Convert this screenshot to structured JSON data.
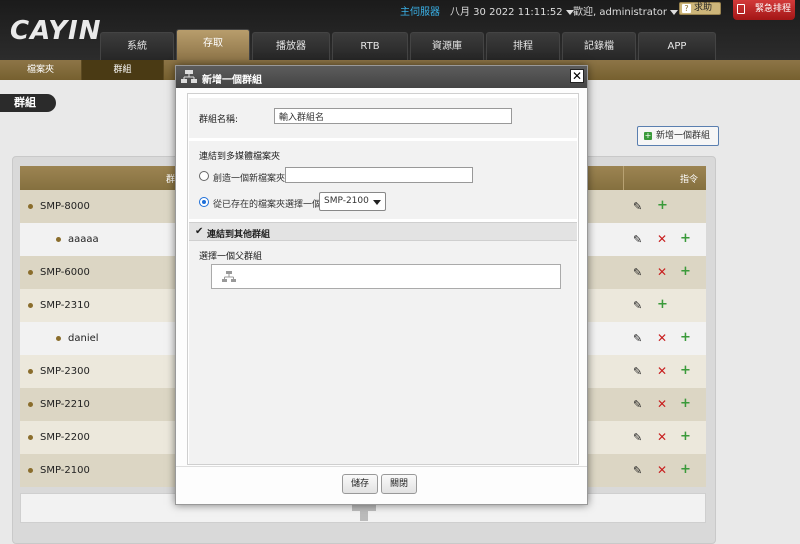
{
  "header": {
    "logo": "CAYIN",
    "server_link": "主伺服器",
    "datetime": "八月 30 2022 11:11:52",
    "user": "歡迎, administrator",
    "help_label": "求助",
    "emergency_label": "緊急排程"
  },
  "nav": {
    "tabs": [
      {
        "label": "系統"
      },
      {
        "label": "存取",
        "active": true
      },
      {
        "label": "播放器"
      },
      {
        "label": "RTB"
      },
      {
        "label": "資源庫"
      },
      {
        "label": "排程"
      },
      {
        "label": "記錄檔"
      },
      {
        "label": "APP"
      }
    ]
  },
  "subnav": {
    "tabs": [
      {
        "label": "檔案夾"
      },
      {
        "label": "群組",
        "active": true
      }
    ]
  },
  "page": {
    "title": "群組",
    "add_group_label": "新增一個群組"
  },
  "table": {
    "col_group": "群",
    "col_command": "指令",
    "rows": [
      {
        "name": "SMP-8000",
        "level": 0,
        "deletable": false
      },
      {
        "name": "aaaaa",
        "level": 1,
        "deletable": true
      },
      {
        "name": "SMP-6000",
        "level": 0,
        "deletable": true
      },
      {
        "name": "SMP-2310",
        "level": 0,
        "deletable": false
      },
      {
        "name": "daniel",
        "level": 1,
        "deletable": true
      },
      {
        "name": "SMP-2300",
        "level": 0,
        "deletable": true
      },
      {
        "name": "SMP-2210",
        "level": 0,
        "deletable": true
      },
      {
        "name": "SMP-2200",
        "level": 0,
        "deletable": true
      },
      {
        "name": "SMP-2100",
        "level": 0,
        "deletable": true
      }
    ]
  },
  "modal": {
    "title": "新增一個群組",
    "name_label": "群組名稱:",
    "name_value": "輸入群組名",
    "link_folder_label": "連結到多媒體檔案夾",
    "create_new_label": "創造一個新檔案夾",
    "existing_label": "從已存在的檔案夾選擇一個",
    "existing_selected": "SMP-2100",
    "link_group_label": "連結到其他群組",
    "parent_label": "選擇一個父群組",
    "save_label": "儲存",
    "close_label": "關閉"
  },
  "colors": {
    "accent": "#8e7549",
    "delete": "#c81e1e",
    "add": "#3a9a3a",
    "link": "#3ab0e6"
  }
}
